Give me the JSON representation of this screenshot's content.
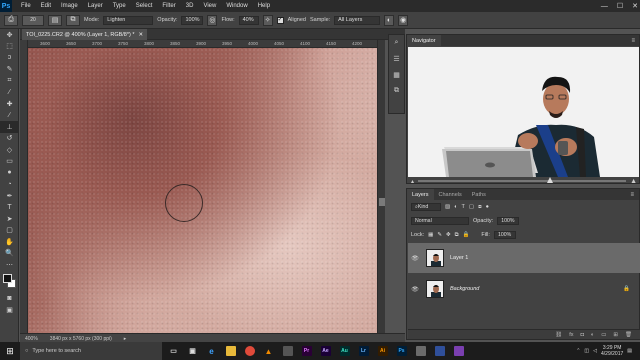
{
  "menubar": {
    "logo": "Ps",
    "items": [
      "File",
      "Edit",
      "Image",
      "Layer",
      "Type",
      "Select",
      "Filter",
      "3D",
      "View",
      "Window",
      "Help"
    ]
  },
  "options": {
    "brush_size": "20",
    "mode_label": "Mode:",
    "mode_value": "Lighten",
    "opacity_label": "Opacity:",
    "opacity_value": "100%",
    "flow_label": "Flow:",
    "flow_value": "40%",
    "aligned_label": "Aligned",
    "sample_label": "Sample:",
    "sample_value": "All Layers"
  },
  "document": {
    "tab_title": "TOI_0225.CR2 @ 400% (Layer 1, RGB/8*) *",
    "zoom": "400%",
    "doc_info": "3840 px x 5760 px (300 ppi)",
    "ruler_ticks": [
      "3600",
      "3650",
      "3700",
      "3750",
      "3800",
      "3850",
      "3900",
      "3950",
      "4000",
      "4050",
      "4100",
      "4150",
      "4200"
    ]
  },
  "navigator": {
    "tab": "Navigator"
  },
  "layers": {
    "tabs": [
      "Layers",
      "Channels",
      "Paths"
    ],
    "kind_label": "Kind",
    "blend_mode": "Normal",
    "opacity_label": "Opacity:",
    "opacity_value": "100%",
    "lock_label": "Lock:",
    "fill_label": "Fill:",
    "fill_value": "100%",
    "items": [
      {
        "name": "Layer 1"
      },
      {
        "name": "Background"
      }
    ]
  },
  "taskbar": {
    "search_placeholder": "Type here to search",
    "time": "3:29 PM",
    "date": "4/29/2017",
    "apps": [
      "Pr",
      "Ae",
      "Au",
      "Lr",
      "Ai"
    ]
  },
  "colors": {
    "accent_blue": "#31a8ff",
    "panel": "#424242"
  }
}
